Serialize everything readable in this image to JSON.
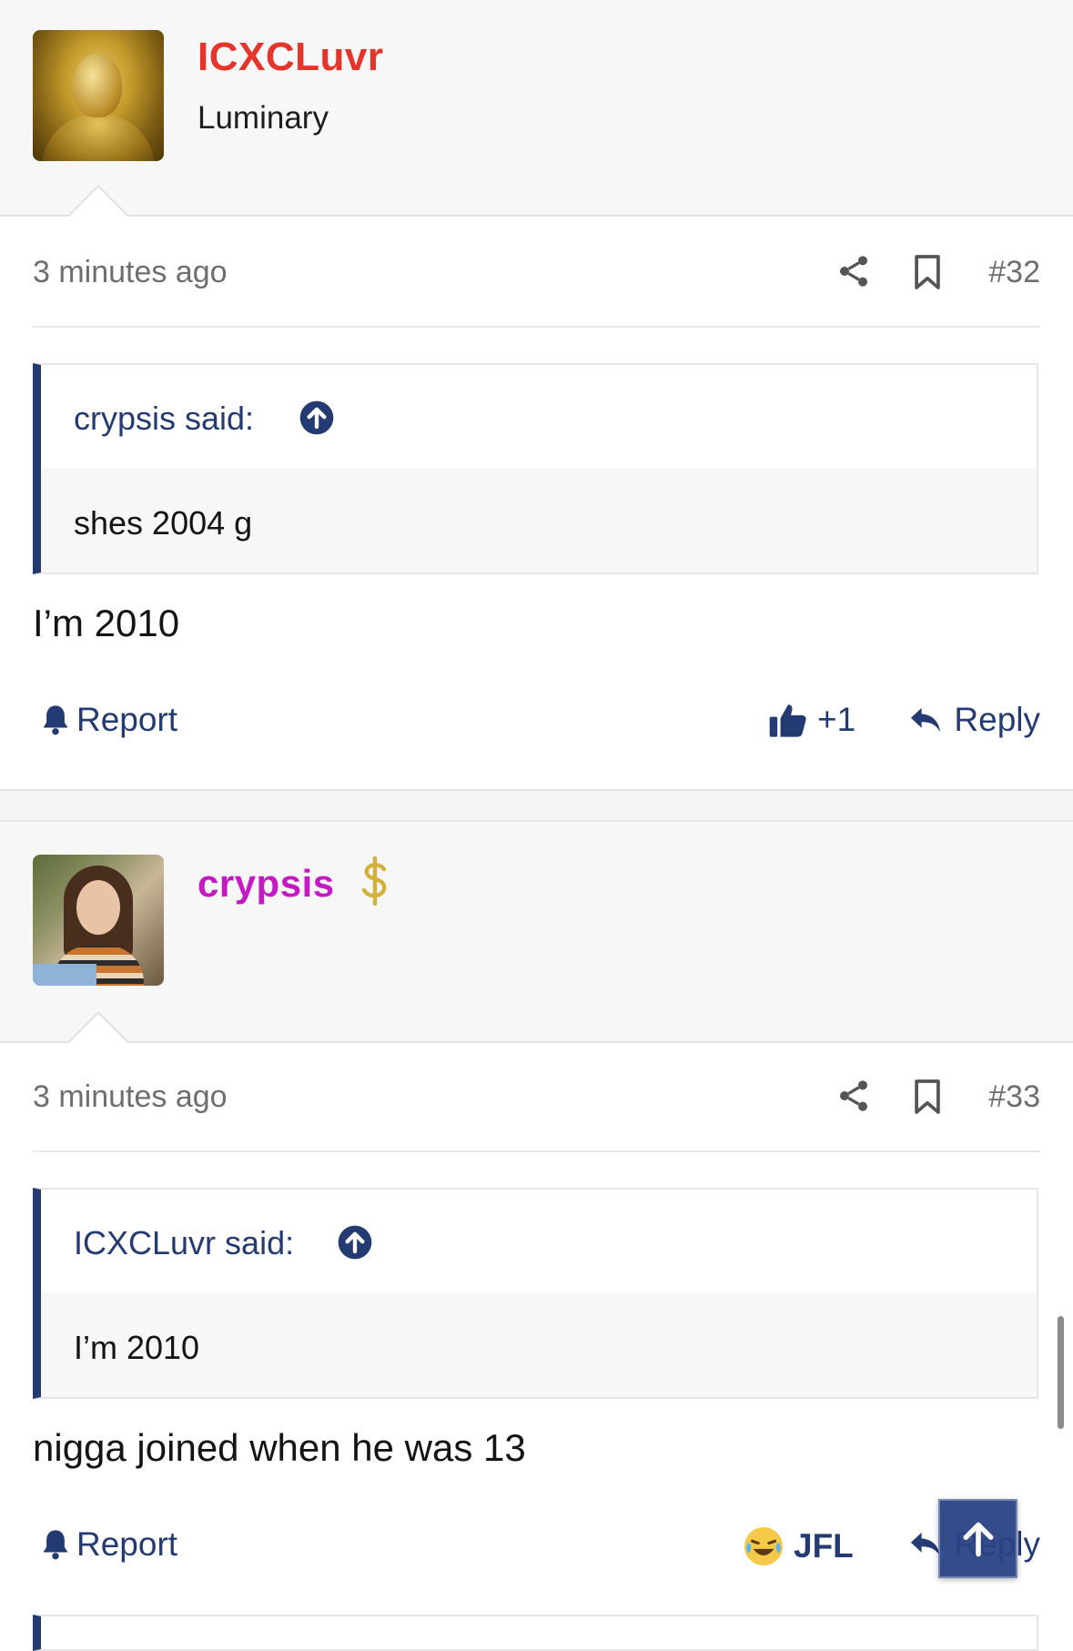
{
  "posts": [
    {
      "username": "ICXCLuvr",
      "user_title": "Luminary",
      "time": "3 minutes ago",
      "post_number": "#32",
      "quote": {
        "author": "crypsis said:",
        "text": "shes 2004 g"
      },
      "body": "I’m 2010",
      "report_label": "Report",
      "reaction": {
        "icon": "thumbs-up-icon",
        "label": "+1"
      },
      "reply_label": "Reply"
    },
    {
      "username": "crypsis",
      "user_badge": "dollar-sign-icon",
      "time": "3 minutes ago",
      "post_number": "#33",
      "quote": {
        "author": "ICXCLuvr said:",
        "text": "I’m 2010"
      },
      "body": "nigga joined when he was 13",
      "report_label": "Report",
      "reaction": {
        "icon": "laughing-crying-emoji-icon",
        "label": "JFL"
      },
      "reply_label": "Reply"
    }
  ],
  "colors": {
    "accent": "#233a72",
    "username_1": "#e5342a",
    "username_2": "#c31ac3",
    "meta_text": "#6e6e6e"
  }
}
